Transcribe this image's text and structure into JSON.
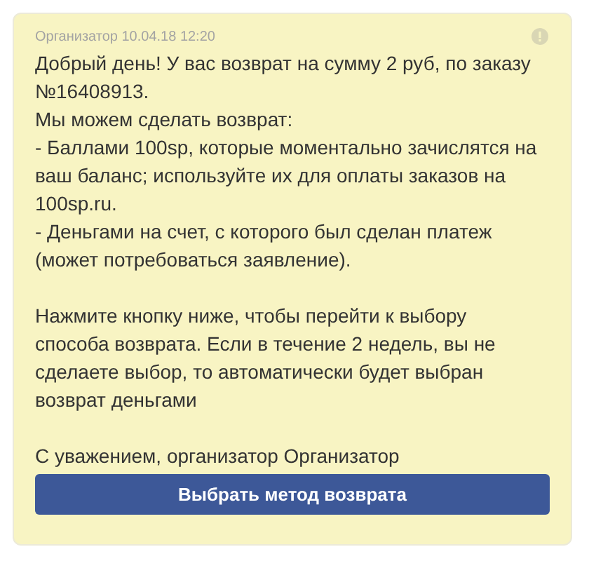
{
  "message": {
    "author": "Организатор",
    "date": "10.04.18 12:20",
    "text": "Добрый день! У вас возврат на сумму 2 руб, по заказу №16408913.\nМы можем сделать возврат:\n- Баллами 100sp, которые моментально зачислятся на ваш баланс; используйте их для оплаты заказов на 100sp.ru.\n- Деньгами на счет, с которого был сделан платеж (может потребоваться заявление).\n\nНажмите кнопку ниже, чтобы перейти к выбору способа возврата. Если в течение 2 недель, вы не сделаете выбор, то автоматически будет выбран возврат деньгами\n\nС уважением, организатор Организатор",
    "button": "Выбрать метод возврата"
  }
}
